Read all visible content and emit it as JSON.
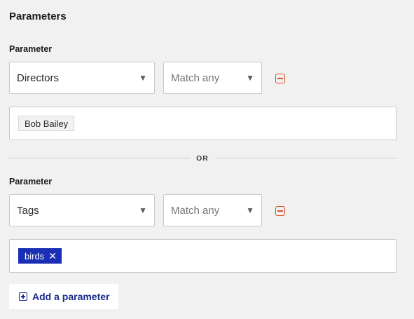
{
  "section": {
    "title": "Parameters"
  },
  "groups": [
    {
      "label": "Parameter",
      "field_select": {
        "value": "Directors"
      },
      "match_select": {
        "value": "Match any"
      },
      "values": [
        {
          "label": "Bob Bailey",
          "selected": false
        }
      ]
    },
    {
      "label": "Parameter",
      "field_select": {
        "value": "Tags"
      },
      "match_select": {
        "value": "Match any"
      },
      "values": [
        {
          "label": "birds",
          "selected": true,
          "remove_glyph": "✕"
        }
      ]
    }
  ],
  "separator": {
    "label": "OR"
  },
  "add_button": {
    "label": "Add a parameter"
  },
  "icons": {
    "caret": "▼",
    "remove": "minus-square-icon",
    "add": "plus-square-icon",
    "chip_remove": "close-icon"
  },
  "colors": {
    "background": "#f1f1f1",
    "remove_accent": "#d9522c",
    "chip_selected": "#1a2fb5",
    "link_blue": "#1a2b8c"
  }
}
